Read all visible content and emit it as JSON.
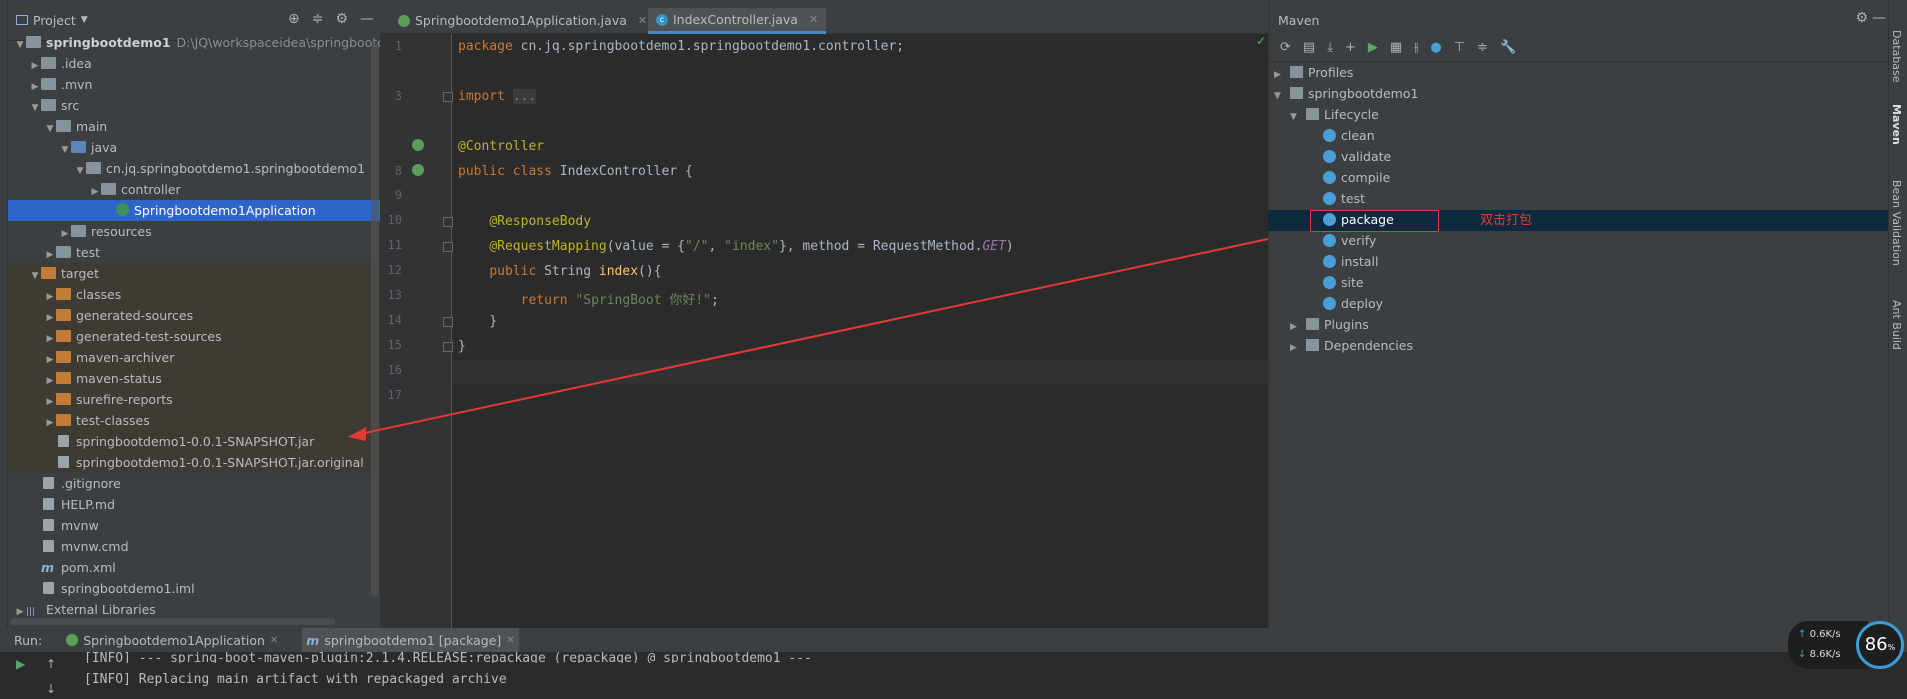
{
  "project": {
    "title": "Project",
    "tree": [
      {
        "label": "springbootdemo1",
        "path": "D:\\JQ\\workspaceidea\\springbootden",
        "depth": 0,
        "arrow": "▼",
        "icon": "fold"
      },
      {
        "label": ".idea",
        "depth": 1,
        "arrow": "▶",
        "icon": "fold"
      },
      {
        "label": ".mvn",
        "depth": 1,
        "arrow": "▶",
        "icon": "fold"
      },
      {
        "label": "src",
        "depth": 1,
        "arrow": "▼",
        "icon": "fold"
      },
      {
        "label": "main",
        "depth": 2,
        "arrow": "▼",
        "icon": "fold"
      },
      {
        "label": "java",
        "depth": 3,
        "arrow": "▼",
        "icon": "blue"
      },
      {
        "label": "cn.jq.springbootdemo1.springbootdemo1",
        "depth": 4,
        "arrow": "▼",
        "icon": "pkg"
      },
      {
        "label": "controller",
        "depth": 5,
        "arrow": "▶",
        "icon": "pkg"
      },
      {
        "label": "Springbootdemo1Application",
        "depth": 6,
        "arrow": "",
        "icon": "cls",
        "selected": true
      },
      {
        "label": "resources",
        "depth": 3,
        "arrow": "▶",
        "icon": "fold"
      },
      {
        "label": "test",
        "depth": 2,
        "arrow": "▶",
        "icon": "fold"
      },
      {
        "label": "target",
        "depth": 1,
        "arrow": "▼",
        "icon": "orange",
        "target": true
      },
      {
        "label": "classes",
        "depth": 2,
        "arrow": "▶",
        "icon": "orange",
        "target": true
      },
      {
        "label": "generated-sources",
        "depth": 2,
        "arrow": "▶",
        "icon": "orange",
        "target": true
      },
      {
        "label": "generated-test-sources",
        "depth": 2,
        "arrow": "▶",
        "icon": "orange",
        "target": true
      },
      {
        "label": "maven-archiver",
        "depth": 2,
        "arrow": "▶",
        "icon": "orange",
        "target": true
      },
      {
        "label": "maven-status",
        "depth": 2,
        "arrow": "▶",
        "icon": "orange",
        "target": true
      },
      {
        "label": "surefire-reports",
        "depth": 2,
        "arrow": "▶",
        "icon": "orange",
        "target": true
      },
      {
        "label": "test-classes",
        "depth": 2,
        "arrow": "▶",
        "icon": "orange",
        "target": true
      },
      {
        "label": "springbootdemo1-0.0.1-SNAPSHOT.jar",
        "depth": 2,
        "arrow": "",
        "icon": "fl",
        "target": true
      },
      {
        "label": "springbootdemo1-0.0.1-SNAPSHOT.jar.original",
        "depth": 2,
        "arrow": "",
        "icon": "fl",
        "target": true
      },
      {
        "label": ".gitignore",
        "depth": 1,
        "arrow": "",
        "icon": "fl"
      },
      {
        "label": "HELP.md",
        "depth": 1,
        "arrow": "",
        "icon": "fl"
      },
      {
        "label": "mvnw",
        "depth": 1,
        "arrow": "",
        "icon": "fl"
      },
      {
        "label": "mvnw.cmd",
        "depth": 1,
        "arrow": "",
        "icon": "fl"
      },
      {
        "label": "pom.xml",
        "depth": 1,
        "arrow": "",
        "icon": "m"
      },
      {
        "label": "springbootdemo1.iml",
        "depth": 1,
        "arrow": "",
        "icon": "fl"
      },
      {
        "label": "External Libraries",
        "depth": 0,
        "arrow": "▶",
        "icon": "lib"
      }
    ]
  },
  "editor": {
    "tabs": [
      {
        "label": "Springbootdemo1Application.java",
        "active": false
      },
      {
        "label": "IndexController.java",
        "active": true
      }
    ],
    "line_numbers": [
      "1",
      "",
      "3",
      "",
      "",
      "8",
      "9",
      "10",
      "11",
      "12",
      "13",
      "14",
      "15",
      "16",
      "17"
    ]
  },
  "maven": {
    "title": "Maven",
    "profiles": "Profiles",
    "project": "springbootdemo1",
    "lifecycle": "Lifecycle",
    "phases": [
      "clean",
      "validate",
      "compile",
      "test",
      "package",
      "verify",
      "install",
      "site",
      "deploy"
    ],
    "plugins": "Plugins",
    "dependencies": "Dependencies",
    "annotation": "双击打包"
  },
  "side_tabs": [
    "Database",
    "Maven",
    "Bean Validation",
    "Ant Build"
  ],
  "run": {
    "label": "Run:",
    "tabs": [
      "Springbootdemo1Application",
      "springbootdemo1 [package]"
    ],
    "lines": [
      "[INFO] --- spring-boot-maven-plugin:2.1.4.RELEASE:repackage (repackage) @ springbootdemo1 ---",
      "[INFO] Replacing main artifact with repackaged archive"
    ]
  },
  "net": {
    "up": "0.6K/s",
    "down": "8.6K/s",
    "percent": "86",
    "unit": "%"
  },
  "colors": {
    "accent": "#2f65ca",
    "annotation": "#e53935",
    "bg": "#2b2b2b",
    "panel": "#3c3f41"
  }
}
